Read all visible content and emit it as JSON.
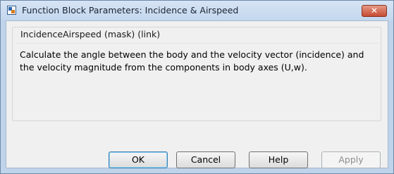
{
  "window": {
    "title": "Function Block Parameters: Incidence & Airspeed",
    "close_glyph": "✕"
  },
  "group": {
    "title": "IncidenceAirspeed (mask) (link)",
    "description": "Calculate the angle between the body and the velocity vector (incidence) and the velocity magnitude from the components in body axes (U,w)."
  },
  "buttons": {
    "ok": "OK",
    "cancel": "Cancel",
    "help": "Help",
    "apply": "Apply"
  },
  "icons": {
    "app": "simulink-block-icon",
    "close": "close-icon"
  },
  "colors": {
    "titlebar": "#c4d7ee",
    "close_button": "#c64b33",
    "dialog_bg": "#f0f0f0",
    "ok_focus": "#3c7fb1"
  }
}
